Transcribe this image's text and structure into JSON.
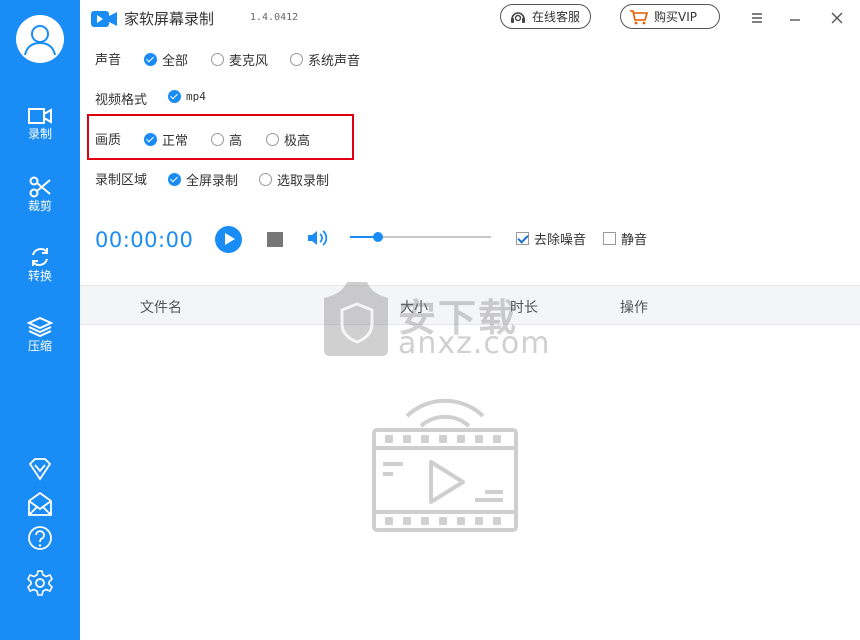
{
  "window": {
    "title": "家软屏幕录制",
    "version": "1.4.0412",
    "online_service_label": "在线客服",
    "buy_vip_label": "购买VIP"
  },
  "sidebar": {
    "items": [
      {
        "label": "录制",
        "icon": "record-icon"
      },
      {
        "label": "裁剪",
        "icon": "scissors-icon"
      },
      {
        "label": "转换",
        "icon": "convert-icon"
      },
      {
        "label": "压缩",
        "icon": "compress-icon"
      }
    ],
    "bottom_icons": [
      "vip-diamond-icon",
      "mail-icon",
      "help-icon",
      "gear-icon"
    ]
  },
  "settings": {
    "sound": {
      "label": "声音",
      "options": [
        {
          "label": "全部",
          "selected": true
        },
        {
          "label": "麦克风",
          "selected": false
        },
        {
          "label": "系统声音",
          "selected": false
        }
      ]
    },
    "format": {
      "label": "视频格式",
      "options": [
        {
          "label": "mp4",
          "selected": true
        }
      ]
    },
    "quality": {
      "label": "画质",
      "options": [
        {
          "label": "正常",
          "selected": true
        },
        {
          "label": "高",
          "selected": false
        },
        {
          "label": "极高",
          "selected": false
        }
      ]
    },
    "area": {
      "label": "录制区域",
      "options": [
        {
          "label": "全屏录制",
          "selected": true
        },
        {
          "label": "选取录制",
          "selected": false
        }
      ]
    }
  },
  "controls": {
    "timer": "00:00:00",
    "volume_fraction": 0.2,
    "denoise": {
      "label": "去除噪音",
      "checked": true
    },
    "mute": {
      "label": "静音",
      "checked": false
    }
  },
  "table": {
    "columns": [
      "文件名",
      "大小",
      "时长",
      "操作"
    ]
  },
  "watermark": {
    "cn": "安下载",
    "en": "anxz.com"
  },
  "colors": {
    "accent": "#1a8cf5",
    "highlight": "#e0000f"
  }
}
